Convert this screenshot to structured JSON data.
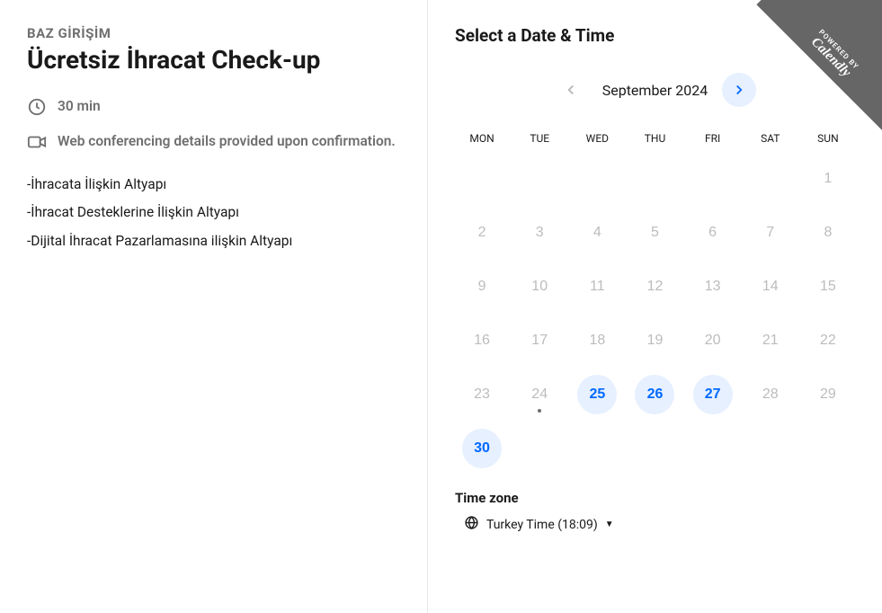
{
  "left": {
    "org_name": "BAZ GİRİŞİM",
    "event_title": "Ücretsiz İhracat Check-up",
    "duration": "30 min",
    "location_note": "Web conferencing details provided upon confirmation.",
    "description_lines": [
      "-İhracata İlişkin Altyapı",
      "-İhracat Desteklerine İlişkin Altyapı",
      "-Dijital İhracat Pazarlamasına ilişkin Altyapı"
    ]
  },
  "right": {
    "title": "Select a Date & Time",
    "month_label": "September 2024",
    "weekdays": [
      "MON",
      "TUE",
      "WED",
      "THU",
      "FRI",
      "SAT",
      "SUN"
    ],
    "days": [
      {
        "n": "",
        "state": "empty"
      },
      {
        "n": "",
        "state": "empty"
      },
      {
        "n": "",
        "state": "empty"
      },
      {
        "n": "",
        "state": "empty"
      },
      {
        "n": "",
        "state": "empty"
      },
      {
        "n": "",
        "state": "empty"
      },
      {
        "n": "1",
        "state": "past"
      },
      {
        "n": "2",
        "state": "past"
      },
      {
        "n": "3",
        "state": "past"
      },
      {
        "n": "4",
        "state": "past"
      },
      {
        "n": "5",
        "state": "past"
      },
      {
        "n": "6",
        "state": "past"
      },
      {
        "n": "7",
        "state": "past"
      },
      {
        "n": "8",
        "state": "past"
      },
      {
        "n": "9",
        "state": "past"
      },
      {
        "n": "10",
        "state": "past"
      },
      {
        "n": "11",
        "state": "past"
      },
      {
        "n": "12",
        "state": "past"
      },
      {
        "n": "13",
        "state": "past"
      },
      {
        "n": "14",
        "state": "past"
      },
      {
        "n": "15",
        "state": "past"
      },
      {
        "n": "16",
        "state": "past"
      },
      {
        "n": "17",
        "state": "past"
      },
      {
        "n": "18",
        "state": "past"
      },
      {
        "n": "19",
        "state": "past"
      },
      {
        "n": "20",
        "state": "past"
      },
      {
        "n": "21",
        "state": "past"
      },
      {
        "n": "22",
        "state": "past"
      },
      {
        "n": "23",
        "state": "past"
      },
      {
        "n": "24",
        "state": "today"
      },
      {
        "n": "25",
        "state": "available"
      },
      {
        "n": "26",
        "state": "available"
      },
      {
        "n": "27",
        "state": "available"
      },
      {
        "n": "28",
        "state": "unavailable"
      },
      {
        "n": "29",
        "state": "unavailable"
      },
      {
        "n": "30",
        "state": "available"
      }
    ],
    "timezone": {
      "label": "Time zone",
      "value": "Turkey Time (18:09)"
    }
  },
  "badge": {
    "powered": "POWERED BY",
    "brand": "Calendly"
  }
}
